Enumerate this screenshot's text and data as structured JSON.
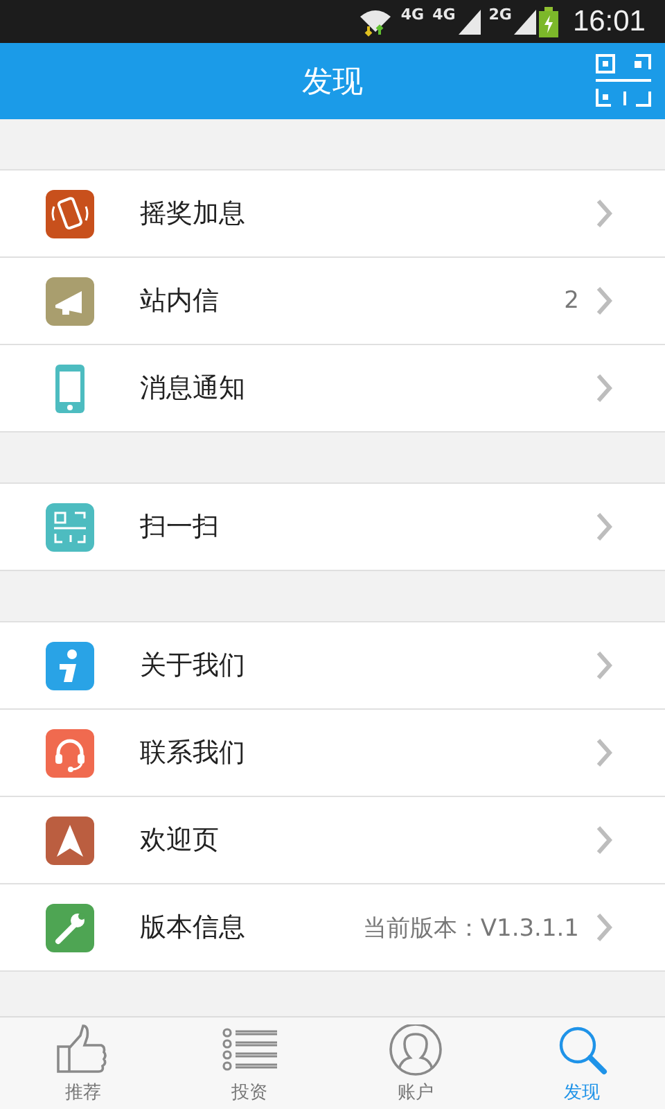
{
  "status_bar": {
    "network_labels": [
      "4G",
      "4G",
      "2G"
    ],
    "time": "16:01"
  },
  "header": {
    "title": "发现"
  },
  "groups": [
    {
      "items": [
        {
          "kind": "shake",
          "color": "#c8501c",
          "label": "摇奖加息"
        },
        {
          "kind": "megaphone",
          "color": "#a99e6e",
          "label": "站内信",
          "value": "2"
        },
        {
          "kind": "phone",
          "color": "#4dbcc0",
          "label": "消息通知"
        }
      ]
    },
    {
      "items": [
        {
          "kind": "scan",
          "color": "#4dbcc0",
          "label": "扫一扫"
        }
      ]
    },
    {
      "items": [
        {
          "kind": "info",
          "color": "#29a3e6",
          "label": "关于我们"
        },
        {
          "kind": "headset",
          "color": "#f06a4f",
          "label": "联系我们"
        },
        {
          "kind": "arrow",
          "color": "#bb5e40",
          "label": "欢迎页"
        },
        {
          "kind": "wrench",
          "color": "#4ea553",
          "label": "版本信息",
          "value": "当前版本：V1.3.1.1"
        }
      ]
    }
  ],
  "tabs": [
    {
      "kind": "thumb",
      "label": "推荐",
      "selected": false
    },
    {
      "kind": "list",
      "label": "投资",
      "selected": false
    },
    {
      "kind": "user",
      "label": "账户",
      "selected": false
    },
    {
      "kind": "search",
      "label": "发现",
      "selected": true
    }
  ]
}
